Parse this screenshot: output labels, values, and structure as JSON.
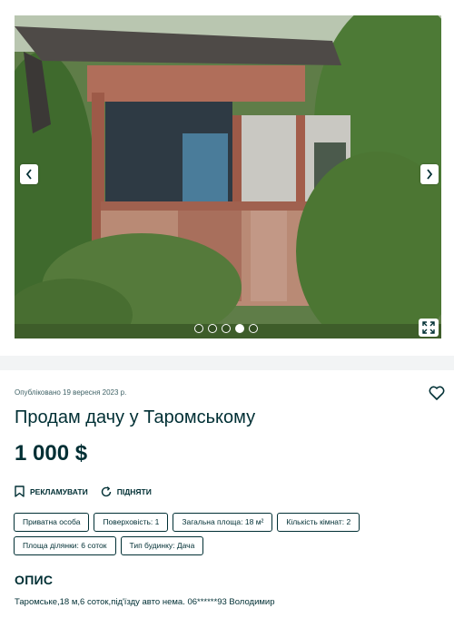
{
  "gallery": {
    "dot_count": 5,
    "active_dot_index": 3
  },
  "listing": {
    "published": "Опубліковано 19 вересня 2023 р.",
    "title": "Продам дачу у Таромському",
    "price": "1 000 $"
  },
  "actions": {
    "promote": "РЕКЛАМУВАТИ",
    "raise": "ПІДНЯТИ"
  },
  "tags": [
    "Приватна особа",
    "Поверховість: 1",
    "Загальна площа: 18 м²",
    "Кількість кімнат: 2",
    "Площа ділянки: 6 соток",
    "Тип будинку: Дача"
  ],
  "description": {
    "heading": "ОПИС",
    "text": "Таромське,18 м,6 соток,під'їзду авто нема. 06******93 Володимир"
  },
  "colors": {
    "primary": "#002f34",
    "divider": "#f2f4f5"
  }
}
